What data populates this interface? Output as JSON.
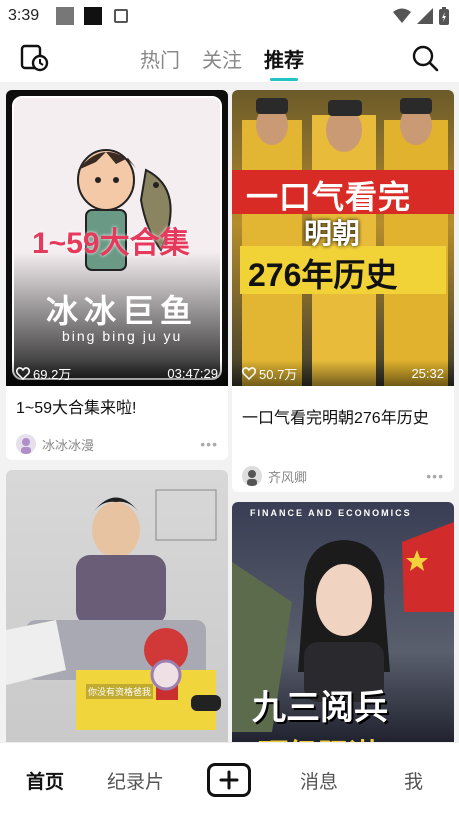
{
  "status": {
    "time": "3:39"
  },
  "tabs": [
    {
      "label": "热门",
      "active": false
    },
    {
      "label": "关注",
      "active": false
    },
    {
      "label": "推荐",
      "active": true
    }
  ],
  "cards": [
    {
      "thumb_title": "1~59大合集",
      "thumb_subtitle": "冰冰巨鱼",
      "thumb_pinyin": "bing bing ju yu",
      "likes": "69.2万",
      "duration": "03:47:29",
      "title": "1~59大合集来啦!",
      "author": "冰冰冰漫"
    },
    {
      "thumb_line1": "一口气看完",
      "thumb_line2": "明朝",
      "thumb_line3": "276年历史",
      "likes": "50.7万",
      "duration": "25:32",
      "title": "一口气看完明朝276年历史",
      "author": "齐风卿"
    },
    {
      "caption": "你没有资格爸我"
    },
    {
      "header": "FINANCE AND ECONOMICS",
      "thumb_title": "九三阅兵",
      "thumb_title_partial": "顶级阳谋"
    }
  ],
  "more_glyph": "•••",
  "nav": [
    {
      "label": "首页",
      "active": true
    },
    {
      "label": "纪录片",
      "active": false
    },
    {
      "label": "消息",
      "active": false
    },
    {
      "label": "我",
      "active": false
    }
  ],
  "colors": {
    "accent": "#22c3c3",
    "background": "#f2f2f2"
  }
}
